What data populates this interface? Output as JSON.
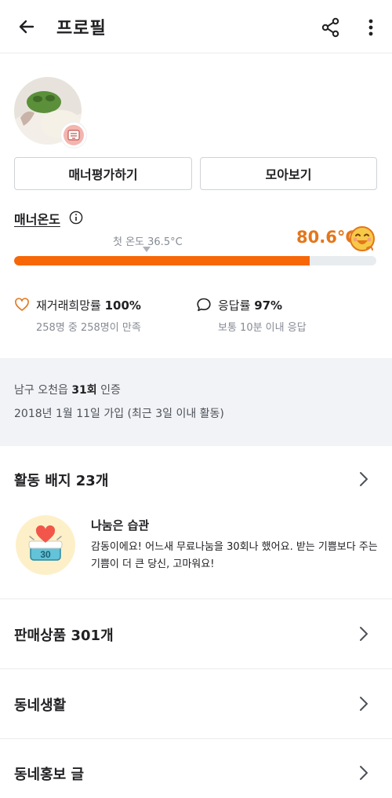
{
  "header": {
    "title": "프로필"
  },
  "profile": {
    "badge_glyph": "至"
  },
  "buttons": {
    "manner_eval": "매너평가하기",
    "collect": "모아보기"
  },
  "manner": {
    "label": "매너온도",
    "first_temp": "첫 온도 36.5°C",
    "value": "80.6°C",
    "fill_percent": 81.5,
    "accent_color": "#f76707",
    "value_color": "#e4761b"
  },
  "stats": {
    "rehire": {
      "label": "재거래희망률",
      "value": "100%",
      "sub": "258명 중 258명이 만족"
    },
    "response": {
      "label": "응답률",
      "value": "97%",
      "sub": "보통 10분 이내 응답"
    }
  },
  "auth": {
    "prefix": "남구 오천읍",
    "count": "31회",
    "suffix": "인증",
    "join": "2018년 1월 11일 가입 (최근 3일 이내 활동)"
  },
  "badges": {
    "title": "활동 배지 23개",
    "item": {
      "number": "30",
      "name": "나눔은 습관",
      "desc": "감동이에요! 어느새 무료나눔을 30회나 했어요. 받는 기쁨보다 주는 기쁨이 더 큰 당신, 고마워요!"
    }
  },
  "sections": {
    "sales": "판매상품 301개",
    "life": "동네생활",
    "promo": "동네홍보 글"
  },
  "icons": {
    "back": "arrow-left-icon",
    "share": "share-icon",
    "more": "more-vertical-icon",
    "info": "info-icon",
    "heart": "heart-icon",
    "chat": "chat-bubble-icon",
    "chevron": "chevron-right-icon"
  }
}
